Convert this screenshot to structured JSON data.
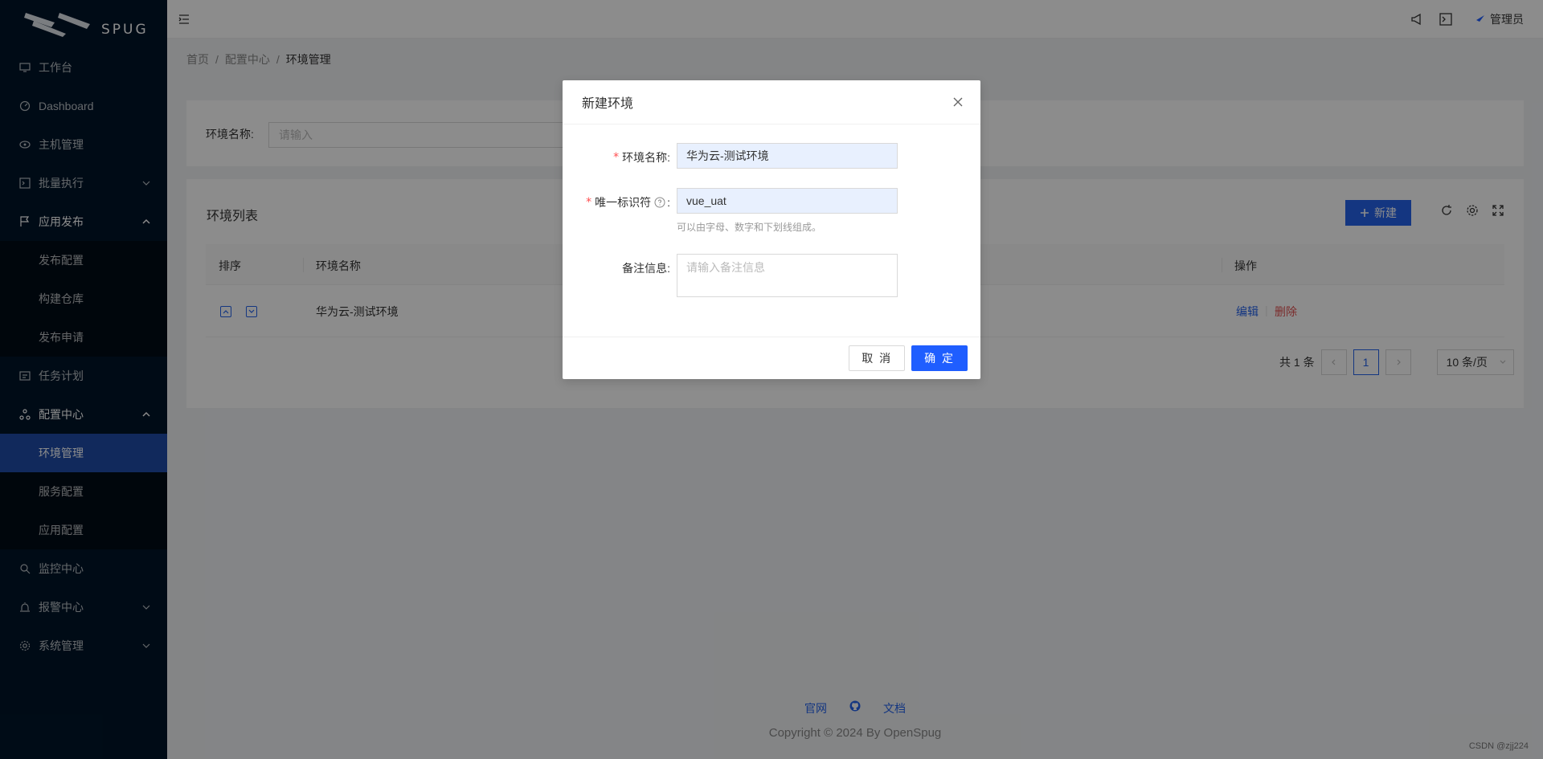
{
  "app": {
    "logo_text": "SPUG"
  },
  "sidebar": {
    "items": [
      {
        "label": "工作台",
        "icon": "desktop-icon"
      },
      {
        "label": "Dashboard",
        "icon": "dashboard-icon"
      },
      {
        "label": "主机管理",
        "icon": "cloud-server-icon"
      },
      {
        "label": "批量执行",
        "icon": "code-icon"
      },
      {
        "label": "应用发布",
        "icon": "flag-icon"
      },
      {
        "label": "发布配置"
      },
      {
        "label": "构建仓库"
      },
      {
        "label": "发布申请"
      },
      {
        "label": "任务计划",
        "icon": "schedule-icon"
      },
      {
        "label": "配置中心",
        "icon": "deployment-icon"
      },
      {
        "label": "环境管理"
      },
      {
        "label": "服务配置"
      },
      {
        "label": "应用配置"
      },
      {
        "label": "监控中心",
        "icon": "monitor-icon"
      },
      {
        "label": "报警中心",
        "icon": "alert-icon"
      },
      {
        "label": "系统管理",
        "icon": "setting-icon"
      }
    ]
  },
  "header": {
    "user_name": "管理员"
  },
  "breadcrumb": {
    "home": "首页",
    "section": "配置中心",
    "current": "环境管理"
  },
  "search": {
    "label": "环境名称:",
    "placeholder": "请输入"
  },
  "table": {
    "title": "环境列表",
    "new_button": "新建",
    "columns": [
      "排序",
      "环境名称",
      "操作"
    ],
    "rows": [
      {
        "name": "华为云-测试环境",
        "edit": "编辑",
        "delete": "删除"
      }
    ]
  },
  "pagination": {
    "total": "共 1 条",
    "current": "1",
    "page_size": "10 条/页"
  },
  "footer": {
    "link1": "官网",
    "link2": "文档",
    "copyright": "Copyright © 2024 By OpenSpug"
  },
  "watermark": "CSDN @zjj224",
  "modal": {
    "title": "新建环境",
    "name_label": "环境名称:",
    "name_value": "华为云-测试环境",
    "key_label": "唯一标识符",
    "key_colon": ":",
    "key_value": "vue_uat",
    "key_help": "可以由字母、数字和下划线组成。",
    "desc_label": "备注信息:",
    "desc_placeholder": "请输入备注信息",
    "cancel": "取 消",
    "ok": "确 定"
  }
}
